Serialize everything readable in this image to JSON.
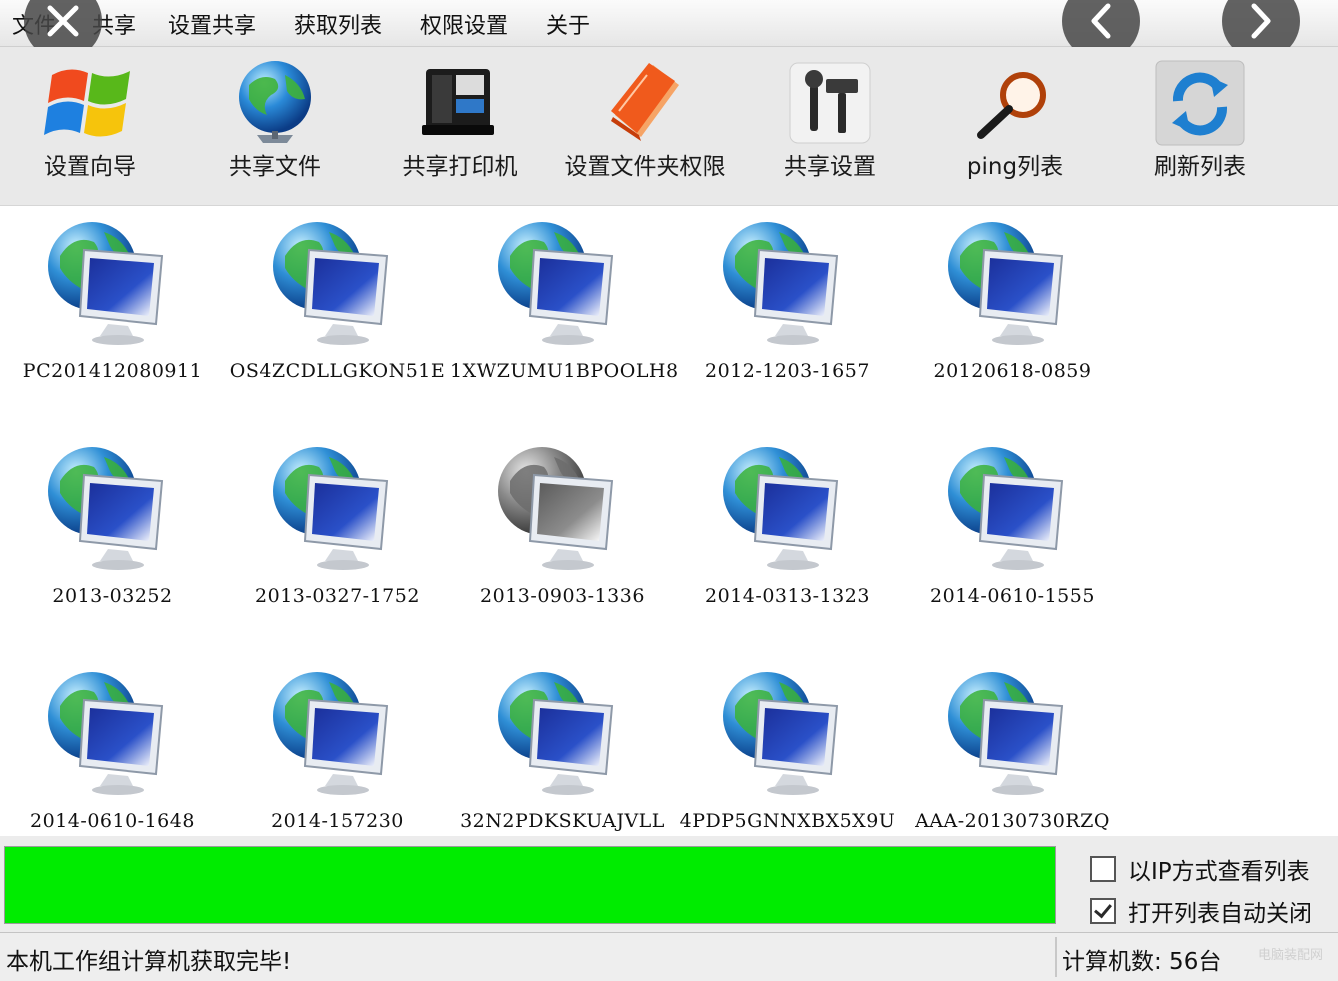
{
  "menu": [
    "文件",
    "共享",
    "设置共享",
    "获取列表",
    "权限设置",
    "关于"
  ],
  "toolbar": [
    {
      "label": "设置向导",
      "icon": "windows-logo-icon"
    },
    {
      "label": "共享文件",
      "icon": "globe-icon"
    },
    {
      "label": "共享打印机",
      "icon": "printer-icon"
    },
    {
      "label": "设置文件夹权限",
      "icon": "folder-book-icon"
    },
    {
      "label": "共享设置",
      "icon": "tools-icon"
    },
    {
      "label": "ping列表",
      "icon": "magnifier-icon"
    },
    {
      "label": "刷新列表",
      "icon": "refresh-icon"
    }
  ],
  "computers": [
    {
      "name": "PC201412080911",
      "online": true
    },
    {
      "name": "OS4ZCDLLGKON51E",
      "online": true
    },
    {
      "name": "1XWZUMU1BPOOLH8",
      "online": true
    },
    {
      "name": "2012-1203-1657",
      "online": true
    },
    {
      "name": "20120618-0859",
      "online": true
    },
    {
      "name": "2013-03252",
      "online": true
    },
    {
      "name": "2013-0327-1752",
      "online": true
    },
    {
      "name": "2013-0903-1336",
      "online": false
    },
    {
      "name": "2014-0313-1323",
      "online": true
    },
    {
      "name": "2014-0610-1555",
      "online": true
    },
    {
      "name": "2014-0610-1648",
      "online": true
    },
    {
      "name": "2014-157230",
      "online": true
    },
    {
      "name": "32N2PDKSKUAJVLL",
      "online": true
    },
    {
      "name": "4PDP5GNNXBX5X9U",
      "online": true
    },
    {
      "name": "AAA-20130730RZQ",
      "online": true
    }
  ],
  "progress": {
    "value": 1.0,
    "color": "#00ec00"
  },
  "options": {
    "view_by_ip": {
      "label": "以IP方式查看列表",
      "checked": false
    },
    "auto_close": {
      "label": "打开列表自动关闭",
      "checked": true
    }
  },
  "status": {
    "message": "本机工作组计算机获取完毕!",
    "count": "计算机数: 56台"
  },
  "watermark": "电脑装配网"
}
